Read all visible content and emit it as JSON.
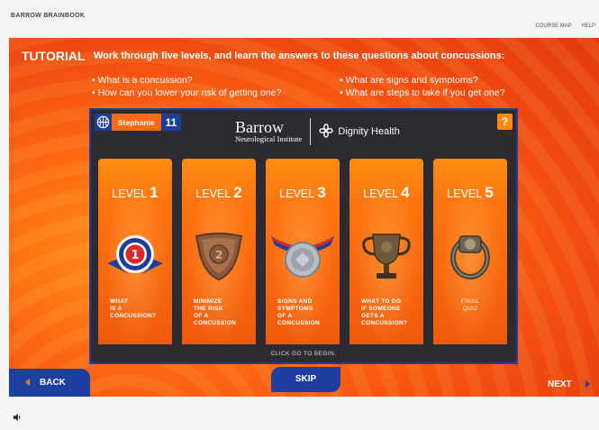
{
  "app": {
    "brand": "BARROW BRAINBOOK"
  },
  "toplinks": {
    "course_map": "COURSE MAP",
    "help": "HELP"
  },
  "tutorial": {
    "label": "TUTORIAL",
    "heading": "Work through five levels, and learn the answers to these questions about concussions:",
    "questions": [
      "• What is a concussion?",
      "• How can you lower your risk of getting one?",
      "• What are signs and symptoms?",
      "• What are steps to take if you get one?"
    ]
  },
  "player": {
    "name": "Stephanie",
    "number": "11"
  },
  "logos": {
    "barrow_line1": "Barrow",
    "barrow_line2": "Neurological Institute",
    "dignity": "Dignity Health"
  },
  "help_button": "?",
  "levels": [
    {
      "prefix": "LEVEL",
      "num": "1",
      "text": "WHAT\nIS A\nCONCUSSION?",
      "icon": "ribbon-medal-icon"
    },
    {
      "prefix": "LEVEL",
      "num": "2",
      "text": "MINIMIZE\nTHE RISK\nOF A\nCONCUSSION",
      "icon": "bronze-shield-icon"
    },
    {
      "prefix": "LEVEL",
      "num": "3",
      "text": "SIGNS AND\nSYMPTOMS\nOF A\nCONCUSSION",
      "icon": "silver-medal-icon"
    },
    {
      "prefix": "LEVEL",
      "num": "4",
      "text": "WHAT TO DO\nIF SOMEONE\nGETS A\nCONCUSSION?",
      "icon": "trophy-icon"
    },
    {
      "prefix": "LEVEL",
      "num": "5",
      "text": "FINAL\nQUIZ",
      "icon": "ring-icon"
    }
  ],
  "card_footer": "CLICK GO TO BEGIN.",
  "nav": {
    "back": "BACK",
    "skip": "SKIP",
    "next": "NEXT"
  },
  "colors": {
    "orange": "#ff6a12",
    "blue": "#1e3fa0",
    "dark": "#2d2a31"
  }
}
